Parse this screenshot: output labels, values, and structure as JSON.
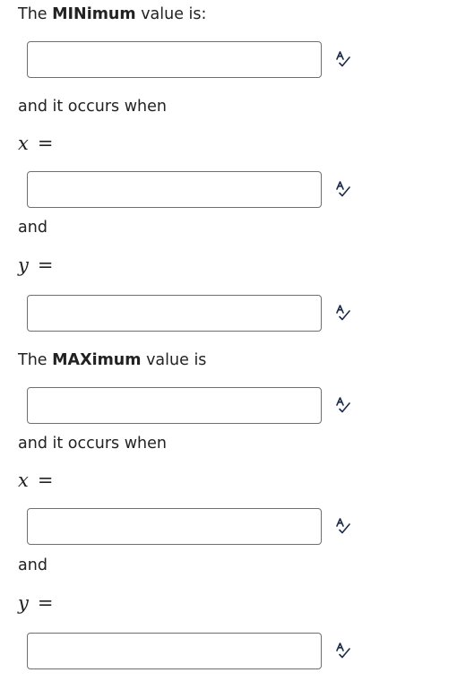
{
  "min": {
    "text_pre": "The ",
    "text_bold": "MINimum",
    "text_post": " value is:",
    "occurs": "and it occurs when",
    "and": "and",
    "x_var": "x",
    "y_var": "y",
    "equals": "="
  },
  "max": {
    "text_pre": "The ",
    "text_bold": "MAXimum",
    "text_post": " value is",
    "occurs": "and it occurs when",
    "and": "and",
    "x_var": "x",
    "y_var": "y",
    "equals": "="
  },
  "inputs": {
    "min_value": "",
    "min_x": "",
    "min_y": "",
    "max_value": "",
    "max_x": "",
    "max_y": ""
  },
  "icons": {
    "spellcheck": "spellcheck-icon"
  }
}
